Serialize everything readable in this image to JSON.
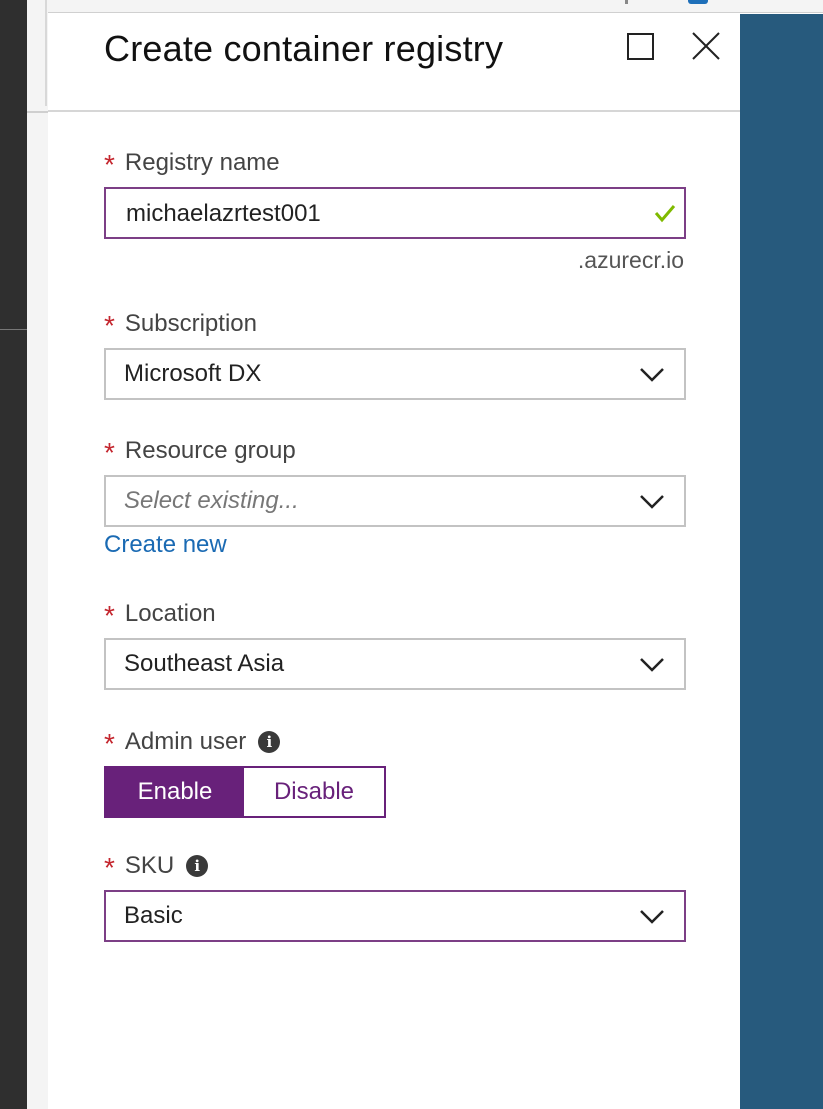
{
  "blade": {
    "title": "Create container registry"
  },
  "form": {
    "registry_name": {
      "label": "Registry name",
      "value": "michaelazrtest001",
      "suffix": ".azurecr.io",
      "valid": true
    },
    "subscription": {
      "label": "Subscription",
      "value": "Microsoft DX"
    },
    "resource_group": {
      "label": "Resource group",
      "placeholder": "Select existing...",
      "create_new_link": "Create new"
    },
    "location": {
      "label": "Location",
      "value": "Southeast Asia"
    },
    "admin_user": {
      "label": "Admin user",
      "options": [
        "Enable",
        "Disable"
      ],
      "selected": "Enable"
    },
    "sku": {
      "label": "SKU",
      "value": "Basic"
    }
  },
  "icons": {
    "maximize": "square-outline-icon",
    "close": "x-close-icon",
    "valid": "checkmark-icon",
    "dropdown": "chevron-down-icon",
    "info": "info-circle-icon"
  },
  "colors": {
    "accent_purple": "#68217a",
    "required_star": "#c4262e",
    "link_blue": "#1a6ab3",
    "valid_green": "#7fba00",
    "side_blue": "#275a7d"
  }
}
